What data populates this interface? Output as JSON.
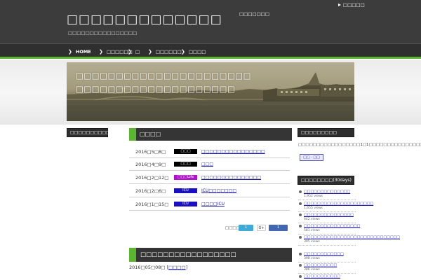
{
  "header": {
    "site_title": "□□□□□□□□□□□□□",
    "tagline": "□□□□□□□□□□□□□□□□",
    "center_link": "□□□□□□□",
    "right_link": "□□□□□"
  },
  "nav": {
    "items": [
      {
        "label": "HOME"
      },
      {
        "label": "□□□□□□"
      },
      {
        "label": "□"
      },
      {
        "label": "□□□□□□"
      },
      {
        "label": "□□□□"
      }
    ]
  },
  "hero": {
    "line1": "□□□□□□□□□□□□□□□□□□□□□□",
    "line2": "□□□□□□□□□□□□□□□□□□□□"
  },
  "left_sidebar": {
    "title": "□□□□□□□□□□"
  },
  "news": {
    "title": "□□□□",
    "rows": [
      {
        "date": "2016□5□8□",
        "category": "□□□",
        "category_color": "#000000",
        "title": "□□□□□□□□□□□□□□□□"
      },
      {
        "date": "2016□4□9□",
        "category": "□□□",
        "category_color": "#000000",
        "title": "□□□"
      },
      {
        "date": "2016□2□12□",
        "category": "□□□Life",
        "category_color": "#b014c8",
        "title": "□□□□□□□□□□□□□□□"
      },
      {
        "date": "2016□2□6□",
        "category": "ICU",
        "category_color": "#1a10c0",
        "title": "ICU□□□□□□□"
      },
      {
        "date": "2016□1□15□",
        "category": "ICU",
        "category_color": "#1a10c0",
        "title": "□□□□ICU"
      }
    ],
    "share_label": "□□□□",
    "tweet_count": "1",
    "gplus_label": "G+",
    "like_count": "1",
    "colors": {
      "tweet": "#3fa9d8",
      "like": "#4267b2",
      "accent": "#5cb531"
    }
  },
  "post": {
    "title": "□□□□□□□□□□□□□□□□□",
    "date": "2016□05□08□",
    "category": "□□□□"
  },
  "right_sidebar": {
    "intro_title": "□□□□□□□□□",
    "intro_text": "□□□□□□□□□□□□□□□□□1□1□□□□□□□□□□□□□□□□",
    "badge": "□□ · □□",
    "ranking_title": "□□□□□□□□(30days)",
    "ranking": [
      {
        "title": "□□□□□□□□□□□□□□",
        "views": "1,952 views"
      },
      {
        "title": "□□□□□□□□□□□□□□□□□□□□□",
        "views": "1,655 views"
      },
      {
        "title": "□□□□□□□□□□□□□□□",
        "views": "642 views"
      },
      {
        "title": "□□□□□□□□□□□□□□□□□",
        "views": "581 views"
      },
      {
        "title": "□□□□□□□□□□□□□□□□□□□□□□□□□□□□□",
        "views": "395 views"
      },
      {
        "title": "□□□□□□□□□□□□",
        "views": "398 views"
      },
      {
        "title": "□□□□□□□□□□",
        "views": "386 views"
      },
      {
        "title": "□□□□□□□□□□□",
        "views": ""
      }
    ]
  }
}
